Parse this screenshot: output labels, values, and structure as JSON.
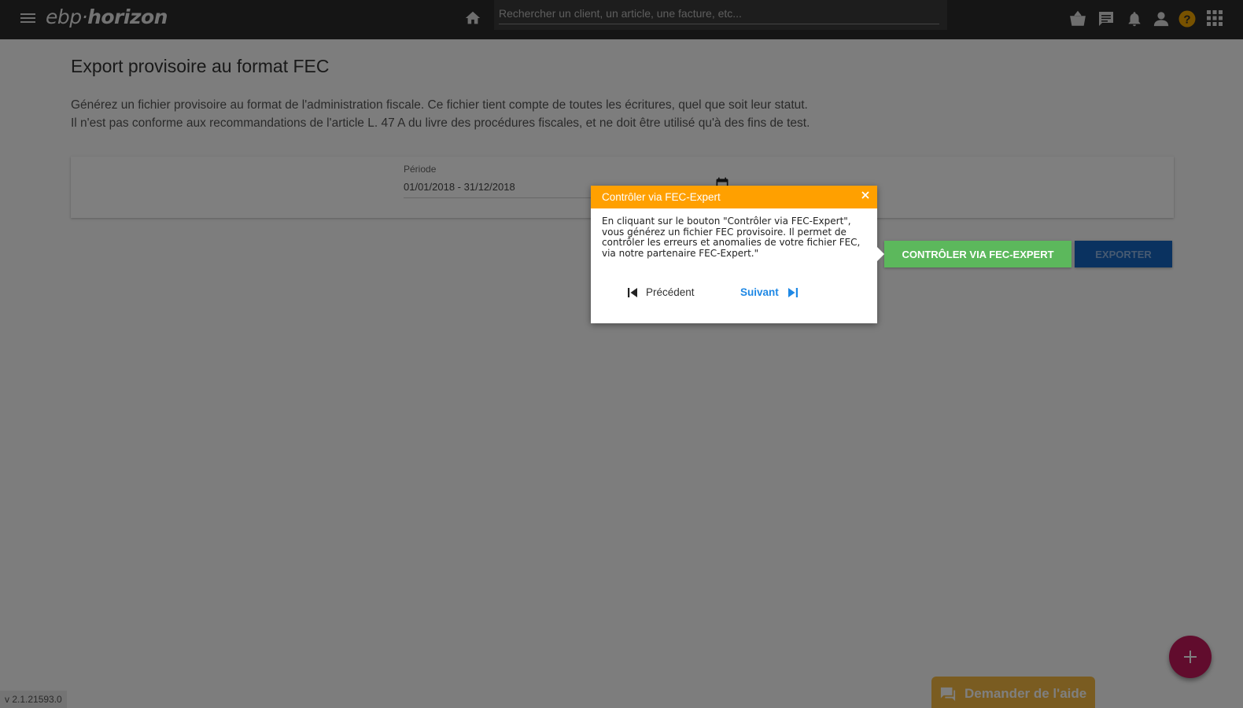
{
  "app": {
    "logo_text_a": "ebp",
    "logo_text_b": "horizon",
    "search_placeholder": "Rechercher un client, un article, une facture, etc...",
    "icons": [
      "menu-icon",
      "home-icon",
      "basket-icon",
      "chat-icon",
      "bell-icon",
      "user-icon",
      "help-icon",
      "apps-grid-icon"
    ],
    "help_icon_color": "#f0a400"
  },
  "page": {
    "title": "Export provisoire au format FEC",
    "description_line1": "Générez un fichier provisoire au format de l'administration fiscale. Ce fichier tient compte de toutes les écritures, quel que soit leur statut.",
    "description_line2": "Il n'est pas conforme aux recommandations de l'article L. 47 A du livre des procédures fiscales, et ne doit être utilisé qu'à des fins de test."
  },
  "period": {
    "label": "Période",
    "value": "01/01/2018 - 31/12/2018"
  },
  "actions": {
    "fec_label": "CONTRÔLER VIA FEC-EXPERT",
    "fec_color": "#5cb85c",
    "export_label": "EXPORTER",
    "export_color": "#1565c0"
  },
  "popover": {
    "title": "Contrôler via FEC-Expert",
    "body_line1": "En cliquant sur le bouton \"Contrôler via FEC-Expert\",",
    "body_line2": "vous générez un fichier FEC provisoire. Il permet de",
    "body_line3": "contrôler les erreurs et anomalies de votre fichier FEC,",
    "body_line4": "via notre partenaire FEC-Expert.\"",
    "prev_label": "Précédent",
    "next_label": "Suivant",
    "header_color": "#ffa000"
  },
  "footer": {
    "version": "v 2.1.21593.0",
    "help_label": "Demander de l'aide"
  }
}
